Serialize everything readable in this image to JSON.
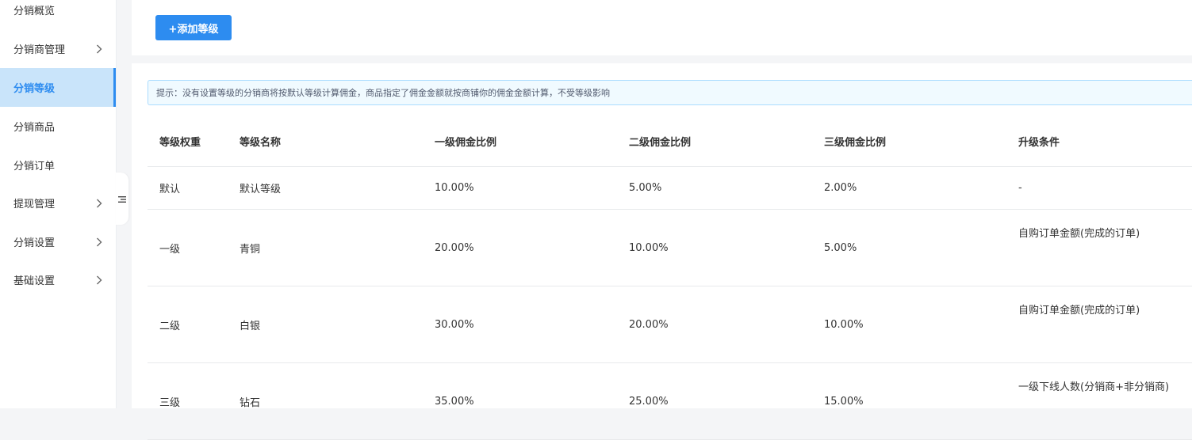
{
  "sidebar": {
    "items": [
      {
        "label": "分销概览",
        "has_arrow": false,
        "active": false
      },
      {
        "label": "分销商管理",
        "has_arrow": true,
        "active": false
      },
      {
        "label": "分销等级",
        "has_arrow": false,
        "active": true
      },
      {
        "label": "分销商品",
        "has_arrow": false,
        "active": false
      },
      {
        "label": "分销订单",
        "has_arrow": false,
        "active": false
      },
      {
        "label": "提现管理",
        "has_arrow": true,
        "active": false
      },
      {
        "label": "分销设置",
        "has_arrow": true,
        "active": false
      },
      {
        "label": "基础设置",
        "has_arrow": true,
        "active": false
      }
    ],
    "collapse_icon": "menu-fold-icon"
  },
  "toolbar": {
    "add_label": "+添加等级"
  },
  "tip": {
    "text": "提示：没有设置等级的分销商将按默认等级计算佣金，商品指定了佣金金额就按商铺你的佣金金额计算，不受等级影响"
  },
  "table": {
    "headers": [
      "等级权重",
      "等级名称",
      "一级佣金比例",
      "二级佣金比例",
      "三级佣金比例",
      "升级条件"
    ],
    "rows": [
      {
        "weight": "默认",
        "name": "默认等级",
        "level1": "10.00%",
        "level2": "5.00%",
        "level3": "2.00%",
        "condition": "-"
      },
      {
        "weight": "一级",
        "name": "青铜",
        "level1": "20.00%",
        "level2": "10.00%",
        "level3": "5.00%",
        "condition": "自购订单金额(完成的订单)"
      },
      {
        "weight": "二级",
        "name": "白银",
        "level1": "30.00%",
        "level2": "20.00%",
        "level3": "10.00%",
        "condition": "自购订单金额(完成的订单)"
      },
      {
        "weight": "三级",
        "name": "钻石",
        "level1": "35.00%",
        "level2": "25.00%",
        "level3": "15.00%",
        "condition": "一级下线人数(分销商+非分销商)"
      }
    ]
  },
  "colors": {
    "primary": "#2d8cf0",
    "active_bg": "#c9e4fa",
    "tip_bg": "#f0faff",
    "tip_border": "#abdcff",
    "page_bg": "#f4f5f7"
  }
}
